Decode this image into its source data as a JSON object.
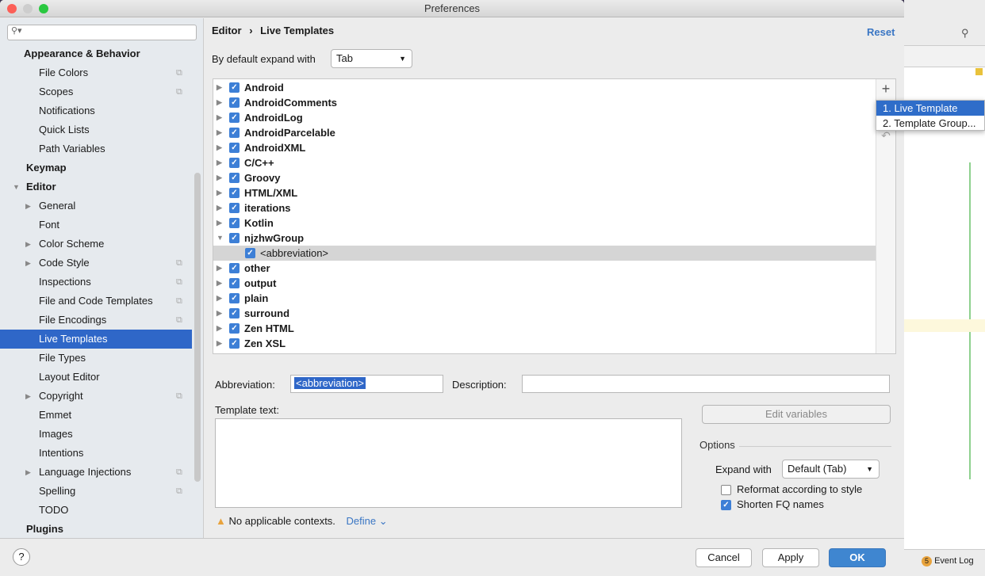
{
  "window": {
    "title": "Preferences"
  },
  "search": {
    "placeholder": ""
  },
  "sidebar": {
    "items": [
      {
        "label": "Appearance & Behavior",
        "bold": true,
        "indent": 30
      },
      {
        "label": "File Colors",
        "indent": 49,
        "copy": true
      },
      {
        "label": "Scopes",
        "indent": 49,
        "copy": true
      },
      {
        "label": "Notifications",
        "indent": 49
      },
      {
        "label": "Quick Lists",
        "indent": 49
      },
      {
        "label": "Path Variables",
        "indent": 49
      },
      {
        "label": "Keymap",
        "bold": true,
        "indent": 33
      },
      {
        "label": "Editor",
        "bold": true,
        "indent": 33,
        "arrow": "down"
      },
      {
        "label": "General",
        "indent": 49,
        "arrow": "right"
      },
      {
        "label": "Font",
        "indent": 49
      },
      {
        "label": "Color Scheme",
        "indent": 49,
        "arrow": "right"
      },
      {
        "label": "Code Style",
        "indent": 49,
        "arrow": "right",
        "copy": true
      },
      {
        "label": "Inspections",
        "indent": 49,
        "copy": true
      },
      {
        "label": "File and Code Templates",
        "indent": 49,
        "copy": true
      },
      {
        "label": "File Encodings",
        "indent": 49,
        "copy": true
      },
      {
        "label": "Live Templates",
        "indent": 49,
        "selected": true
      },
      {
        "label": "File Types",
        "indent": 49
      },
      {
        "label": "Layout Editor",
        "indent": 49
      },
      {
        "label": "Copyright",
        "indent": 49,
        "arrow": "right",
        "copy": true
      },
      {
        "label": "Emmet",
        "indent": 49
      },
      {
        "label": "Images",
        "indent": 49
      },
      {
        "label": "Intentions",
        "indent": 49
      },
      {
        "label": "Language Injections",
        "indent": 49,
        "arrow": "right",
        "copy": true
      },
      {
        "label": "Spelling",
        "indent": 49,
        "copy": true
      },
      {
        "label": "TODO",
        "indent": 49
      },
      {
        "label": "Plugins",
        "bold": true,
        "indent": 33
      }
    ]
  },
  "breadcrumb": {
    "parent": "Editor",
    "sep": "›",
    "current": "Live Templates"
  },
  "reset_label": "Reset",
  "expand_default": {
    "label": "By default expand with",
    "value": "Tab"
  },
  "tree": [
    {
      "label": "Android",
      "arrow": "right"
    },
    {
      "label": "AndroidComments",
      "arrow": "right"
    },
    {
      "label": "AndroidLog",
      "arrow": "right"
    },
    {
      "label": "AndroidParcelable",
      "arrow": "right"
    },
    {
      "label": "AndroidXML",
      "arrow": "right"
    },
    {
      "label": "C/C++",
      "arrow": "right"
    },
    {
      "label": "Groovy",
      "arrow": "right"
    },
    {
      "label": "HTML/XML",
      "arrow": "right"
    },
    {
      "label": "iterations",
      "arrow": "right"
    },
    {
      "label": "Kotlin",
      "arrow": "right"
    },
    {
      "label": "njzhwGroup",
      "arrow": "down"
    },
    {
      "label": "<abbreviation>",
      "child": true,
      "selected": true
    },
    {
      "label": "other",
      "arrow": "right"
    },
    {
      "label": "output",
      "arrow": "right"
    },
    {
      "label": "plain",
      "arrow": "right"
    },
    {
      "label": "surround",
      "arrow": "right"
    },
    {
      "label": "Zen HTML",
      "arrow": "right"
    },
    {
      "label": "Zen XSL",
      "arrow": "right"
    }
  ],
  "popup": {
    "items": [
      "1. Live Template",
      "2. Template Group..."
    ]
  },
  "form": {
    "abbreviation_label": "Abbreviation:",
    "abbreviation_value": "<abbreviation>",
    "description_label": "Description:",
    "description_value": "",
    "template_text_label": "Template text:",
    "edit_variables": "Edit variables",
    "options_label": "Options",
    "expand_with_label": "Expand with",
    "expand_with_value": "Default (Tab)",
    "reformat_label": "Reformat according to style",
    "reformat_checked": false,
    "shorten_label": "Shorten FQ names",
    "shorten_checked": true,
    "warning": "No applicable contexts.",
    "define": "Define"
  },
  "footer": {
    "help": "?",
    "cancel": "Cancel",
    "apply": "Apply",
    "ok": "OK"
  },
  "ide": {
    "event_log": "Event Log",
    "event_count": "5"
  },
  "colors": {
    "accent": "#2f67c8",
    "ok": "#3f86d0",
    "warning": "#e8a33d"
  }
}
